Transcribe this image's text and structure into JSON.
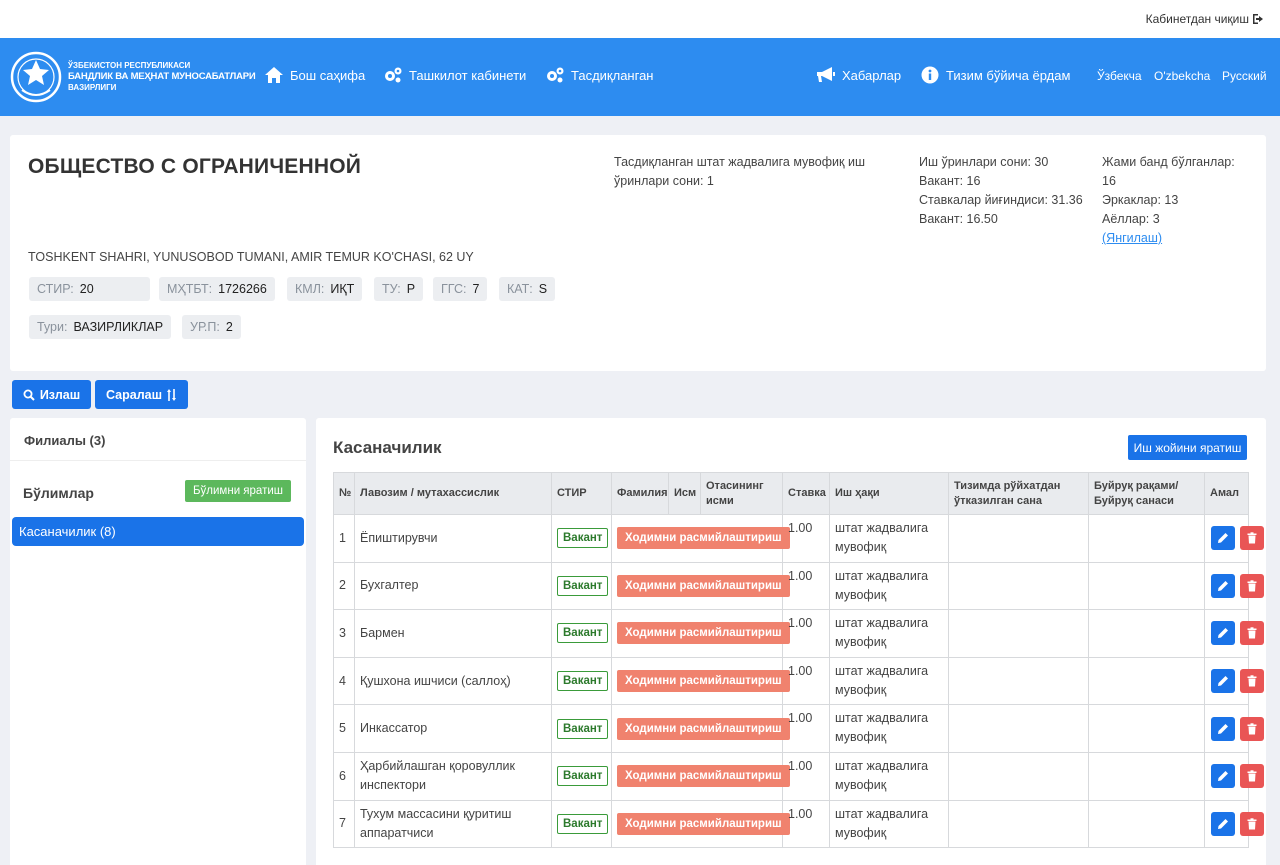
{
  "topbar": {
    "logout_label": "Кабинетдан чиқиш"
  },
  "brand": {
    "line1": "Ўзбекистон Республикаси",
    "line2": "Бандлик ва меҳнат муносабатлари",
    "line3": "вазирлиги"
  },
  "nav": {
    "home": "Бош саҳифа",
    "org_cabinet": "Ташкилот кабинети",
    "approved": "Тасдиқланган",
    "news": "Хабарлар",
    "help": "Тизим бўйича ёрдам"
  },
  "languages": [
    "Ўзбекча",
    "O'zbekcha",
    "Русский"
  ],
  "organization": {
    "title": "ОБЩЕСТВО С ОГРАНИЧЕННОЙ",
    "approved_places": "Тасдиқланган штат жадвалига мувофиқ иш ўринлари сони: 1",
    "jobs_count": "Иш ўринлари сони: 30",
    "vacant1": "Вакант: 16",
    "rate_sum": "Ставкалар йиғиндиси: 31.36",
    "vacant2": "Вакант: 16.50",
    "total_busy_label": "Жами банд бўлганлар:",
    "total_busy_value": "16",
    "men": "Эркаклар: 13",
    "women": "Аёллар: 3",
    "refresh": "(Янгилаш)",
    "address": "TOSHKENT SHAHRI, YUNUSOBOD TUMANI, AMIR TEMUR KO'CHASI, 62 UY",
    "chips": [
      {
        "key": "СТИР:",
        "value": "20"
      },
      {
        "key": "МҲТБТ:",
        "value": "1726266"
      },
      {
        "key": "КМЛ:",
        "value": "ИҚТ"
      },
      {
        "key": "ТУ:",
        "value": "Р"
      },
      {
        "key": "ГГС:",
        "value": "7"
      },
      {
        "key": "КАТ:",
        "value": "S"
      },
      {
        "key": "Тури:",
        "value": "ВАЗИРЛИКЛАР"
      },
      {
        "key": "УР.П:",
        "value": "2"
      }
    ]
  },
  "toolbar": {
    "search": "Излаш",
    "sort": "Саралаш"
  },
  "sidebar": {
    "branches": "Филиалы (3)",
    "departments": "Бўлимлар",
    "create_dept": "Бўлимни яратиш",
    "active_dept": "Касаначилик (8)"
  },
  "main": {
    "title": "Касаначилик",
    "create_job": "Иш жойини яратиш",
    "headers": [
      "№",
      "Лавозим / мутахассислик",
      "СТИР",
      "Фамилия",
      "Исм",
      "Отасининг исми",
      "Ставка",
      "Иш ҳақи",
      "Тизимда рўйхатдан ўтказилган сана",
      "Буйруқ рақами/ Буйруқ санаси",
      "Амал"
    ],
    "vacant_label": "Вакант",
    "register_label": "Ходимни расмийлаштириш",
    "rows": [
      {
        "n": "1",
        "position": "Ёпиштирувчи",
        "rate": "1.00",
        "salary": "штат жадвалига мувофиқ"
      },
      {
        "n": "2",
        "position": "Бухгалтер",
        "rate": "1.00",
        "salary": "штат жадвалига мувофиқ"
      },
      {
        "n": "3",
        "position": "Бармен",
        "rate": "1.00",
        "salary": "штат жадвалига мувофиқ"
      },
      {
        "n": "4",
        "position": "Қушхона ишчиси (саллоҳ)",
        "rate": "1.00",
        "salary": "штат жадвалига мувофиқ"
      },
      {
        "n": "5",
        "position": "Инкассатор",
        "rate": "1.00",
        "salary": "штат жадвалига мувофиқ"
      },
      {
        "n": "6",
        "position": "Ҳарбийлашган қоровуллик инспектори",
        "rate": "1.00",
        "salary": "штат жадвалига мувофиқ"
      },
      {
        "n": "7",
        "position": "Тухум массасини қуритиш аппаратчиси",
        "rate": "1.00",
        "salary": "штат жадвалига мувофиқ"
      }
    ]
  }
}
